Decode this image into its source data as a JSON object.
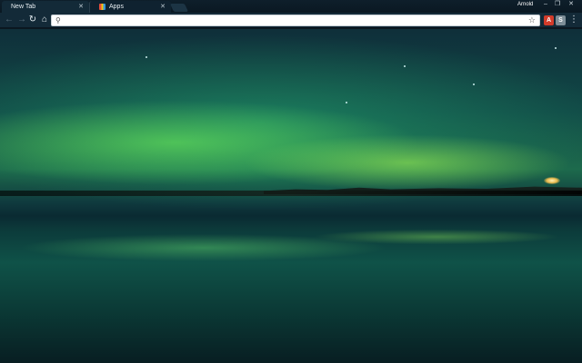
{
  "tabs": [
    {
      "label": "New Tab",
      "active": true
    },
    {
      "label": "Apps",
      "active": false
    }
  ],
  "profile": {
    "name": "Arnold"
  },
  "omnibox": {
    "value": "",
    "placeholder": ""
  },
  "icons": {
    "back": "arrow-left-icon",
    "forward": "arrow-right-icon",
    "reload": "reload-icon",
    "home": "home-icon",
    "search": "search-icon",
    "bookmark": "star-icon",
    "menu": "kebab-menu-icon"
  },
  "extensions": [
    {
      "label": "A",
      "color": "#d23b2a"
    },
    {
      "label": "S",
      "color": "#7d8d97"
    }
  ],
  "theme": {
    "accent": "#132a38",
    "aurora": "#5cf06a"
  }
}
